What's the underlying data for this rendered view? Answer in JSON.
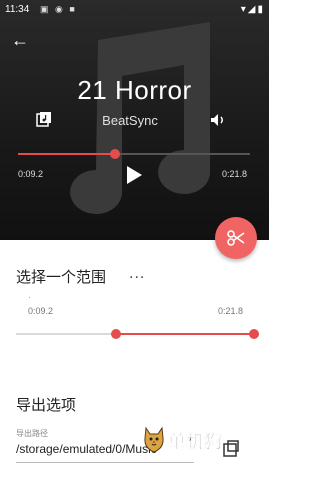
{
  "status_bar": {
    "time": "11:34"
  },
  "player": {
    "title": "21 Horror",
    "artist": "BeatSync",
    "current_time": "0:09.2",
    "total_time": "0:21.8",
    "progress_fraction": 0.42
  },
  "range": {
    "title": "选择一个范围",
    "more": "...",
    "start_label": "0:09.2",
    "end_label": "0:21.8",
    "start_fraction": 0.42,
    "end_fraction": 1.0
  },
  "export": {
    "title": "导出选项",
    "path_label": "导出路径",
    "path_value": "/storage/emulated/0/Music"
  },
  "watermark": {
    "text": "单机狗"
  },
  "colors": {
    "accent": "#e74c4c",
    "fab": "#f06464"
  }
}
